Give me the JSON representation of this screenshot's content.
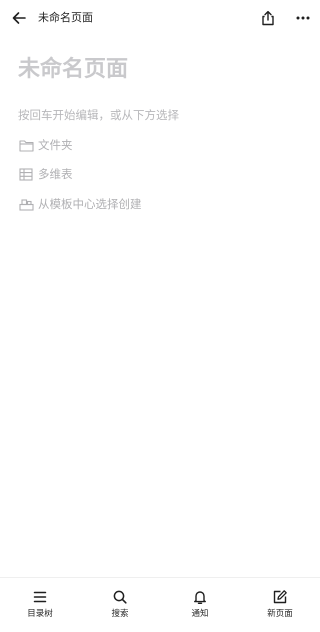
{
  "header": {
    "title": "未命名页面",
    "back_icon": "arrow-left-icon",
    "share_icon": "share-icon",
    "more_icon": "more-horizontal-icon"
  },
  "page": {
    "title_placeholder": "未命名页面",
    "hint": "按回车开始编辑，或从下方选择",
    "options": [
      {
        "label": "文件夹",
        "icon": "folder-icon"
      },
      {
        "label": "多维表",
        "icon": "table-icon"
      },
      {
        "label": "从模板中心选择创建",
        "icon": "template-icon"
      }
    ]
  },
  "tabbar": {
    "items": [
      {
        "label": "目录树",
        "icon": "menu-icon"
      },
      {
        "label": "搜索",
        "icon": "search-icon"
      },
      {
        "label": "通知",
        "icon": "bell-icon"
      },
      {
        "label": "新页面",
        "icon": "edit-icon"
      }
    ]
  },
  "colors": {
    "text": "#1f1f1f",
    "placeholder": "#c9c9cc",
    "hint": "#b7b7ba",
    "divider": "#efefef"
  }
}
